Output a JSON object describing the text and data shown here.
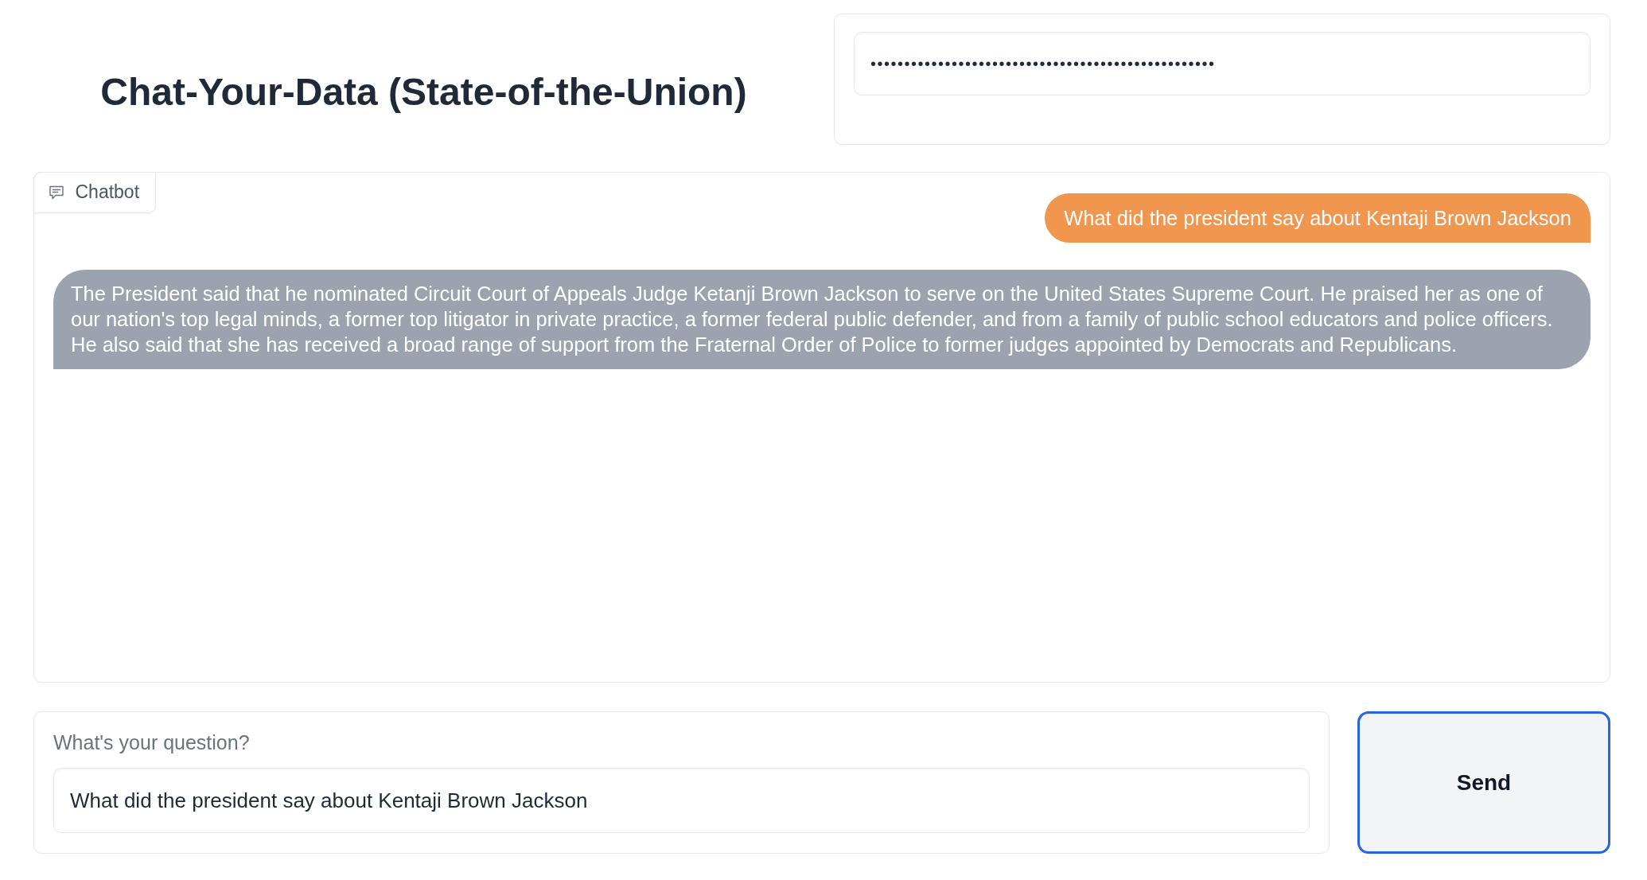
{
  "header": {
    "title": "Chat-Your-Data (State-of-the-Union)"
  },
  "api_key_field": {
    "value": "•••••••••••••••••••••••••••••••••••••••••••••••••••"
  },
  "chatbot": {
    "label": "Chatbot",
    "messages": [
      {
        "kind": "user",
        "text": "What did the president say about Kentaji Brown Jackson"
      },
      {
        "kind": "bot",
        "text": "The President said that he nominated Circuit Court of Appeals Judge Ketanji Brown Jackson to serve on the United States Supreme Court. He praised her as one of our nation's top legal minds, a former top litigator in private practice, a former federal public defender, and from a family of public school educators and police officers. He also said that she has received a broad range of support from the Fraternal Order of Police to former judges appointed by Democrats and Republicans."
      }
    ]
  },
  "question": {
    "label": "What's your question?",
    "value": "What did the president say about Kentaji Brown Jackson"
  },
  "send_button": {
    "label": "Send"
  }
}
